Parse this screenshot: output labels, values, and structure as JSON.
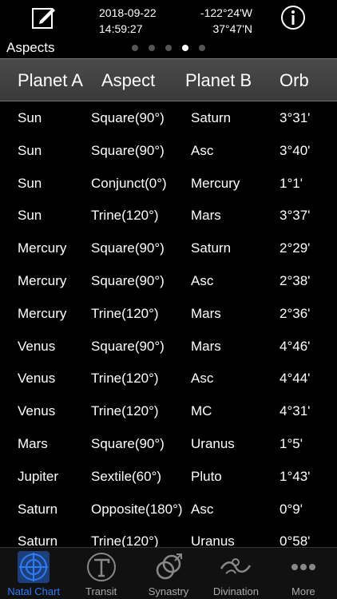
{
  "header_info": {
    "date": "2018-09-22",
    "time": "14:59:27",
    "longitude": "-122°24'W",
    "latitude": "37°47'N"
  },
  "section_title": "Aspects",
  "pager": {
    "count": 5,
    "active_index": 3
  },
  "table": {
    "columns": [
      "Planet A",
      "Aspect",
      "Planet B",
      "Orb"
    ],
    "rows": [
      [
        "Sun",
        "Square(90°)",
        "Saturn",
        "3°31'"
      ],
      [
        "Sun",
        "Square(90°)",
        "Asc",
        "3°40'"
      ],
      [
        "Sun",
        "Conjunct(0°)",
        "Mercury",
        "1°1'"
      ],
      [
        "Sun",
        "Trine(120°)",
        "Mars",
        "3°37'"
      ],
      [
        "Mercury",
        "Square(90°)",
        "Saturn",
        "2°29'"
      ],
      [
        "Mercury",
        "Square(90°)",
        "Asc",
        "2°38'"
      ],
      [
        "Mercury",
        "Trine(120°)",
        "Mars",
        "2°36'"
      ],
      [
        "Venus",
        "Square(90°)",
        "Mars",
        "4°46'"
      ],
      [
        "Venus",
        "Trine(120°)",
        "Asc",
        "4°44'"
      ],
      [
        "Venus",
        "Trine(120°)",
        "MC",
        "4°31'"
      ],
      [
        "Mars",
        "Square(90°)",
        "Uranus",
        "1°5'"
      ],
      [
        "Jupiter",
        "Sextile(60°)",
        "Pluto",
        "1°43'"
      ],
      [
        "Saturn",
        "Opposite(180°)",
        "Asc",
        "0°9'"
      ],
      [
        "Saturn",
        "Trine(120°)",
        "Uranus",
        "0°58'"
      ]
    ]
  },
  "tabs": [
    {
      "label": "Natal Chart",
      "icon": "natal-chart-icon",
      "active": true
    },
    {
      "label": "Transit",
      "icon": "transit-icon",
      "active": false
    },
    {
      "label": "Synastry",
      "icon": "synastry-icon",
      "active": false
    },
    {
      "label": "Divination",
      "icon": "divination-icon",
      "active": false
    },
    {
      "label": "More",
      "icon": "more-icon",
      "active": false
    }
  ],
  "colors": {
    "accent": "#2e7bf6",
    "background": "#000000",
    "header_bg": "#3f3f3f"
  }
}
